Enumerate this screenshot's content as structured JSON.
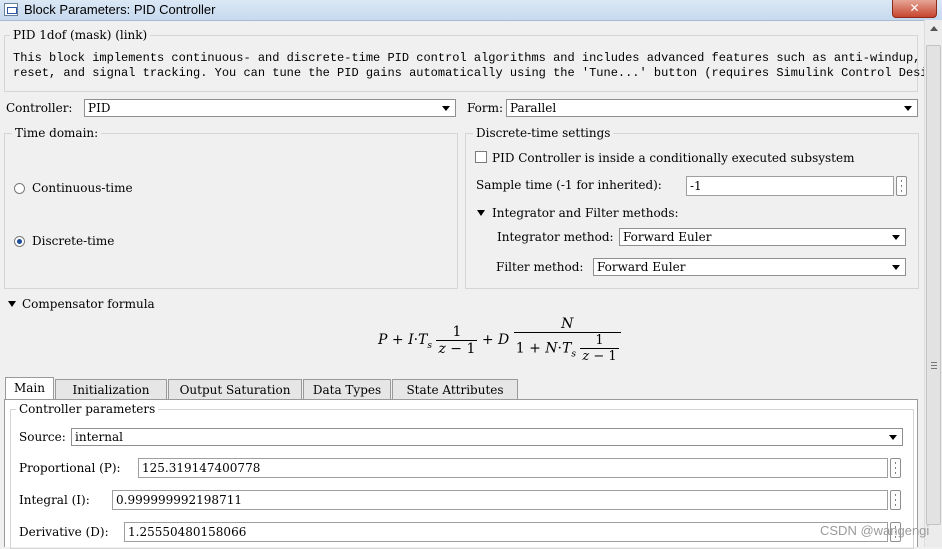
{
  "window": {
    "title": "Block Parameters: PID Controller",
    "close_glyph": "✕"
  },
  "header": {
    "group_label": "PID 1dof (mask) (link)",
    "description_line1": "This block implements continuous- and discrete-time PID control algorithms and includes advanced features such as anti-windup, external",
    "description_line2": "reset, and signal tracking. You can tune the PID gains automatically using the 'Tune...' button (requires Simulink Control Design)."
  },
  "controller": {
    "label": "Controller:",
    "value": "PID"
  },
  "form": {
    "label": "Form:",
    "value": "Parallel"
  },
  "time_domain": {
    "label": "Time domain:",
    "continuous": "Continuous-time",
    "discrete": "Discrete-time",
    "selected": "discrete"
  },
  "discrete_settings": {
    "label": "Discrete-time settings",
    "subsystem_checkbox": "PID Controller is inside a conditionally executed subsystem",
    "subsystem_checked": false,
    "sample_time_label": "Sample time (-1 for inherited):",
    "sample_time_value": "-1",
    "methods_label": "Integrator and Filter methods:",
    "integrator_label": "Integrator method:",
    "integrator_value": "Forward Euler",
    "filter_label": "Filter method:",
    "filter_value": "Forward Euler"
  },
  "compensator": {
    "label": "Compensator formula"
  },
  "tabs": [
    {
      "label": "Main",
      "active": true
    },
    {
      "label": "Initialization",
      "active": false
    },
    {
      "label": "Output Saturation",
      "active": false
    },
    {
      "label": "Data Types",
      "active": false
    },
    {
      "label": "State Attributes",
      "active": false
    }
  ],
  "main": {
    "group_label": "Controller parameters",
    "source_label": "Source:",
    "source_value": "internal",
    "proportional_label": "Proportional (P):",
    "proportional_value": "125.319147400778",
    "integral_label": "Integral (I):",
    "integral_value": "0.999999992198711",
    "derivative_label": "Derivative (D):",
    "derivative_value": "1.25550480158066"
  },
  "watermark": "CSDN @wangengi",
  "icons": [
    "window-icon",
    "close-icon",
    "dropdown-arrow-icon",
    "ellipsis-icon",
    "collapse-triangle-icon",
    "scroll-up-icon"
  ]
}
